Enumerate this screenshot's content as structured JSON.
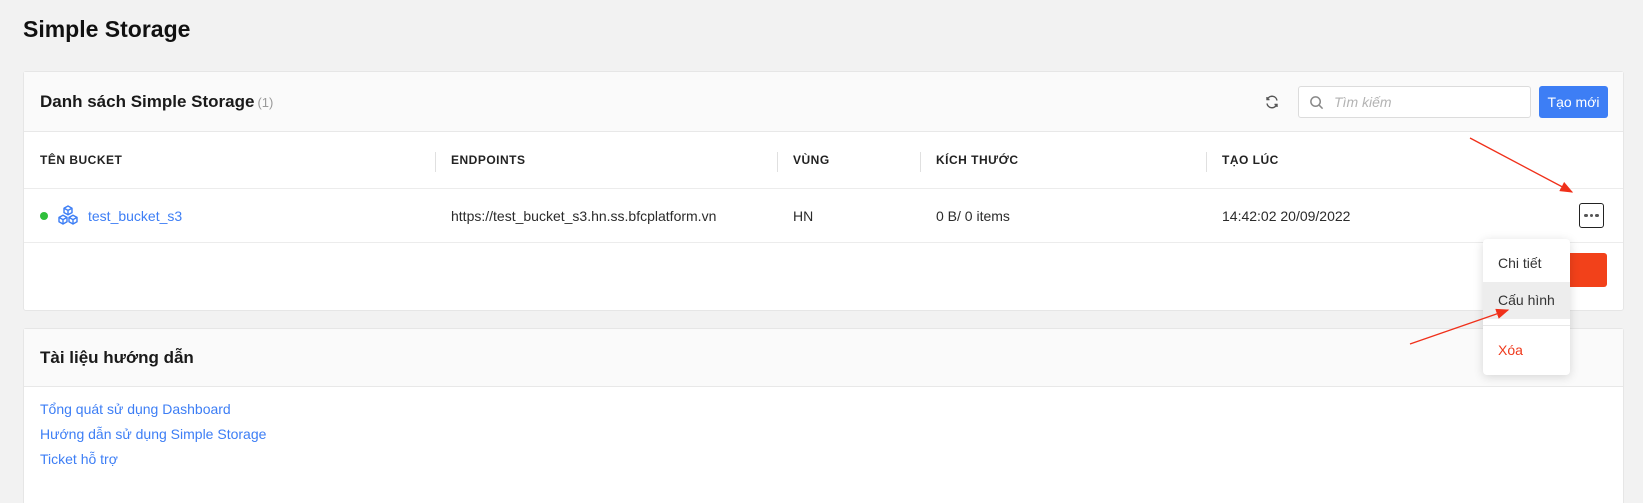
{
  "page": {
    "title": "Simple Storage"
  },
  "list": {
    "title": "Danh sách Simple Storage",
    "count": "(1)",
    "search_placeholder": "Tìm kiếm",
    "create_label": "Tạo mới",
    "columns": [
      "TÊN BUCKET",
      "ENDPOINTS",
      "VÙNG",
      "KÍCH THƯỚC",
      "TẠO LÚC"
    ],
    "rows": [
      {
        "name": "test_bucket_s3",
        "endpoint": "https://test_bucket_s3.hn.ss.bfcplatform.vn",
        "region": "HN",
        "size": "0 B/ 0 items",
        "created": "14:42:02 20/09/2022",
        "status_color": "#2fbf3b"
      }
    ]
  },
  "menu": {
    "items": [
      "Chi tiết",
      "Cấu hình"
    ],
    "danger_item": "Xóa"
  },
  "docs": {
    "title": "Tài liệu hướng dẫn",
    "links": [
      "Tổng quát sử dụng Dashboard",
      "Hướng dẫn sử dụng Simple Storage",
      "Ticket hỗ trợ"
    ]
  },
  "colors": {
    "accent": "#3d7ef5",
    "danger": "#ef3a1d",
    "status_active": "#2fbf3b",
    "annotation": "#f0301a"
  }
}
